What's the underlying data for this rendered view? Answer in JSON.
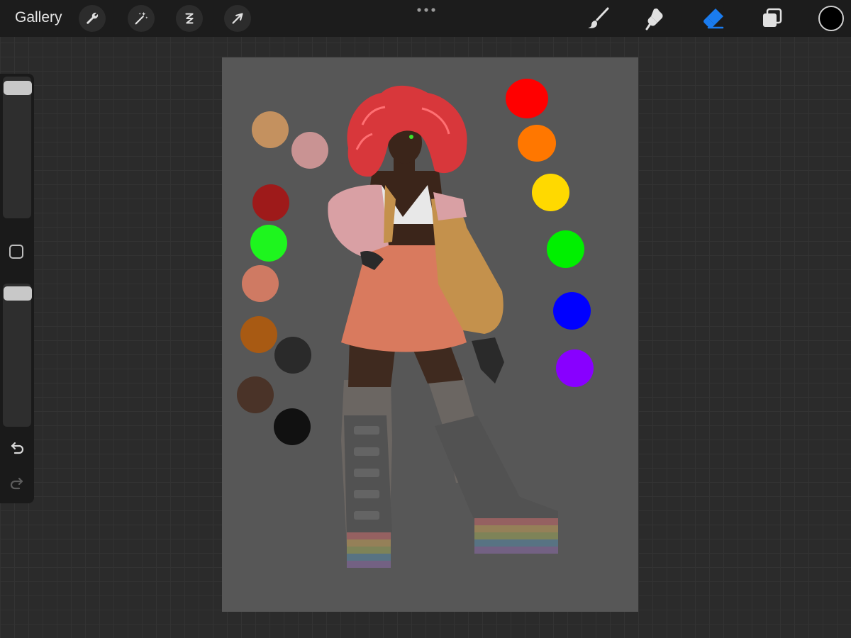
{
  "toolbar": {
    "gallery_label": "Gallery",
    "left_tools": [
      "wrench-icon",
      "magic-wand-icon",
      "selection-icon",
      "transform-arrow-icon"
    ],
    "right_tools": [
      "brush-icon",
      "smudge-icon",
      "eraser-icon",
      "layers-icon"
    ],
    "active_tool": "eraser-icon",
    "accent_color": "#1a7cf0",
    "current_color": "#000000"
  },
  "sidebar": {
    "brush_size_level": 0.0,
    "opacity_level": 0.0,
    "icons": [
      "modify-square-icon",
      "undo-icon",
      "redo-icon"
    ]
  },
  "canvas": {
    "background_color": "#575757",
    "palette_left": [
      "#c4915f",
      "#c99393",
      "#9e1a1a",
      "#1ef51e",
      "#cf7a63",
      "#a85a13",
      "#2a2a2a",
      "#4a3328",
      "#111111"
    ],
    "palette_right": [
      "#ff0000",
      "#ff7700",
      "#ffd900",
      "#00f000",
      "#0000ff",
      "#8800ff"
    ]
  }
}
